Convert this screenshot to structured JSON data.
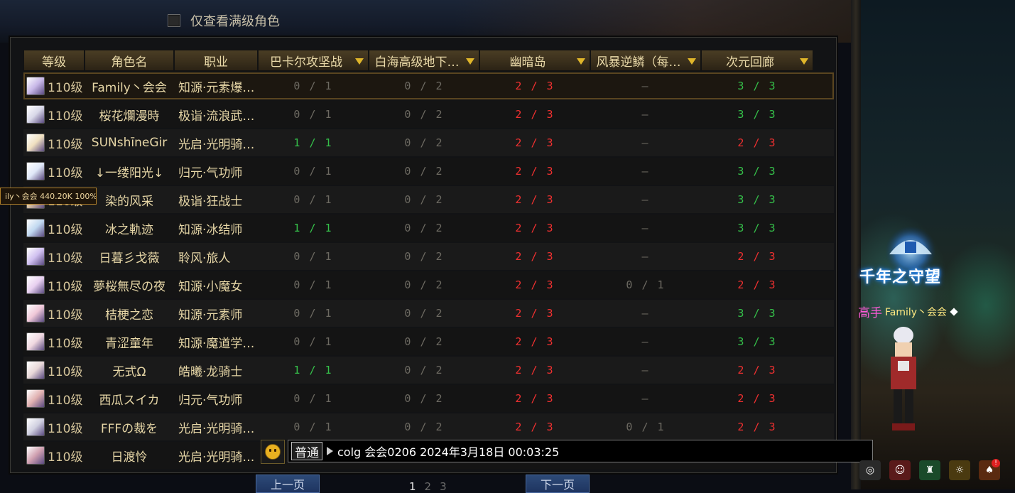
{
  "filter": {
    "checkbox_label": "仅查看满级角色",
    "checked": false
  },
  "table": {
    "headers": [
      {
        "label": "等级",
        "dropdown": false
      },
      {
        "label": "角色名",
        "dropdown": false
      },
      {
        "label": "职业",
        "dropdown": false
      },
      {
        "label": "巴卡尔攻坚战",
        "dropdown": true
      },
      {
        "label": "白海高级地下…",
        "dropdown": true
      },
      {
        "label": "幽暗岛",
        "dropdown": true
      },
      {
        "label": "风暴逆鳞（每…",
        "dropdown": true
      },
      {
        "label": "次元回廊",
        "dropdown": true
      }
    ],
    "rows": [
      {
        "level": "110级",
        "name": "Family丶会会",
        "job": "知源·元素爆…",
        "c1": "0 / 1",
        "c2": "0 / 2",
        "c3": "2 / 3",
        "c4": "–",
        "c5": "3 / 3",
        "selected": true
      },
      {
        "level": "110级",
        "name": "桜花爛漫時",
        "job": "极诣·流浪武…",
        "c1": "0 / 1",
        "c2": "0 / 2",
        "c3": "2 / 3",
        "c4": "–",
        "c5": "3 / 3"
      },
      {
        "level": "110级",
        "name": "SUNshīneGir",
        "job": "光启·光明骑…",
        "c1": "1 / 1",
        "c2": "0 / 2",
        "c3": "2 / 3",
        "c4": "–",
        "c5": "2 / 3"
      },
      {
        "level": "110级",
        "name": "↓一缕阳光↓",
        "job": "归元·气功师",
        "c1": "0 / 1",
        "c2": "0 / 2",
        "c3": "2 / 3",
        "c4": "–",
        "c5": "3 / 3"
      },
      {
        "level": "110级",
        "name": "染的风采",
        "job": "极诣·狂战士",
        "c1": "0 / 1",
        "c2": "0 / 2",
        "c3": "2 / 3",
        "c4": "–",
        "c5": "3 / 3"
      },
      {
        "level": "110级",
        "name": "冰之軌迹",
        "job": "知源·冰结师",
        "c1": "1 / 1",
        "c2": "0 / 2",
        "c3": "2 / 3",
        "c4": "–",
        "c5": "3 / 3"
      },
      {
        "level": "110级",
        "name": "日暮彡戈薇",
        "job": "聆风·旅人",
        "c1": "0 / 1",
        "c2": "0 / 2",
        "c3": "2 / 3",
        "c4": "–",
        "c5": "2 / 3"
      },
      {
        "level": "110级",
        "name": "夢桜無尽の夜",
        "job": "知源·小魔女",
        "c1": "0 / 1",
        "c2": "0 / 2",
        "c3": "2 / 3",
        "c4": "0 / 1",
        "c5": "2 / 3"
      },
      {
        "level": "110级",
        "name": "桔梗之恋",
        "job": "知源·元素师",
        "c1": "0 / 1",
        "c2": "0 / 2",
        "c3": "2 / 3",
        "c4": "–",
        "c5": "3 / 3"
      },
      {
        "level": "110级",
        "name": "青涩童年",
        "job": "知源·魔道学…",
        "c1": "0 / 1",
        "c2": "0 / 2",
        "c3": "2 / 3",
        "c4": "–",
        "c5": "3 / 3"
      },
      {
        "level": "110级",
        "name": "无式Ω",
        "job": "皓曦·龙骑士",
        "c1": "1 / 1",
        "c2": "0 / 2",
        "c3": "2 / 3",
        "c4": "–",
        "c5": "2 / 3"
      },
      {
        "level": "110级",
        "name": "西瓜スイカ",
        "job": "归元·气功师",
        "c1": "0 / 1",
        "c2": "0 / 2",
        "c3": "2 / 3",
        "c4": "–",
        "c5": "2 / 3"
      },
      {
        "level": "110级",
        "name": "FFFの裁を",
        "job": "光启·光明骑…",
        "c1": "0 / 1",
        "c2": "0 / 2",
        "c3": "2 / 3",
        "c4": "0 / 1",
        "c5": "2 / 3"
      },
      {
        "level": "110级",
        "name": "日渡怜",
        "job": "光启·光明骑…",
        "c1": "",
        "c2": "",
        "c3": "",
        "c4": "",
        "c5": ""
      }
    ]
  },
  "tooltip": {
    "text": "ily丶会会  440.20K 100%"
  },
  "chat": {
    "channel": "普通",
    "message": "colg 会会0206 2024年3月18日 00:03:25"
  },
  "pager": {
    "prev_label": "上一页",
    "next_label": "下一页",
    "pages": [
      "1",
      "2",
      "3"
    ],
    "current": "1"
  },
  "side": {
    "guild_title": "千年之守望",
    "player_rank": "高手",
    "player_name": "Family丶会会"
  },
  "colors": {
    "gray": "#6d6a62",
    "red": "#f03030",
    "green": "#35c04a",
    "header_gold": "#e9d9a8",
    "dropdown_arrow": "#e0b62a"
  }
}
